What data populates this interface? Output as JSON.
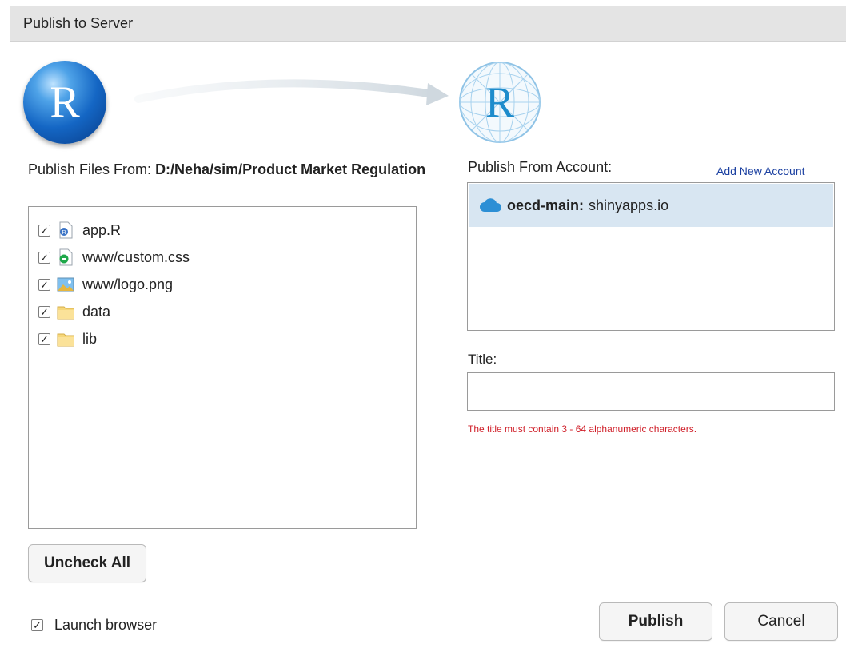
{
  "dialog": {
    "title": "Publish to Server"
  },
  "source": {
    "logo_letter": "R",
    "label_prefix": "Publish Files From:",
    "path": "D:/Neha/sim/Product Market Regulation"
  },
  "files": [
    {
      "name": "app.R",
      "checked": true,
      "icon": "r-file-icon"
    },
    {
      "name": "www/custom.css",
      "checked": true,
      "icon": "css-file-icon"
    },
    {
      "name": "www/logo.png",
      "checked": true,
      "icon": "image-file-icon"
    },
    {
      "name": "data",
      "checked": true,
      "icon": "folder-icon"
    },
    {
      "name": "lib",
      "checked": true,
      "icon": "folder-icon"
    }
  ],
  "uncheck_all_label": "Uncheck All",
  "launch_browser": {
    "label": "Launch browser",
    "checked": true
  },
  "destination": {
    "logo_letter": "R",
    "account_label": "Publish From Account:",
    "add_account_label": "Add New Account",
    "accounts": [
      {
        "name": "oecd-main:",
        "server": "shinyapps.io",
        "selected": true
      }
    ]
  },
  "title_field": {
    "label": "Title:",
    "value": "",
    "error": "The title must contain 3 - 64 alphanumeric characters."
  },
  "buttons": {
    "publish": "Publish",
    "cancel": "Cancel"
  },
  "colors": {
    "title_bar": "#e4e4e4",
    "selected_row": "#d8e6f2",
    "error": "#d0202a",
    "link": "#1a3fa0",
    "cloud": "#2d8fd5"
  }
}
